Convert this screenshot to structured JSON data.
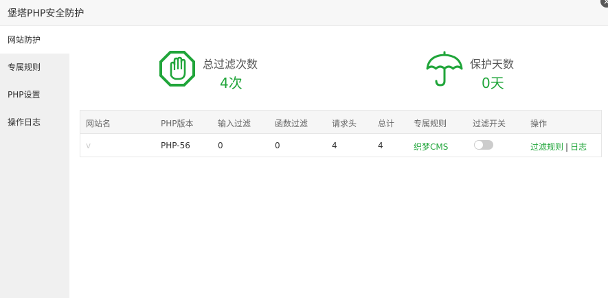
{
  "window": {
    "title": "堡塔PHP安全防护",
    "close_icon": "close-icon"
  },
  "sidebar": {
    "items": [
      {
        "label": "网站防护",
        "active": true
      },
      {
        "label": "专属规则",
        "active": false
      },
      {
        "label": "PHP设置",
        "active": false
      },
      {
        "label": "操作日志",
        "active": false
      }
    ]
  },
  "stats": {
    "filter": {
      "label": "总过滤次数",
      "value": "4次",
      "icon": "stop-hand-icon"
    },
    "protect": {
      "label": "保护天数",
      "value": "0天",
      "icon": "umbrella-icon"
    }
  },
  "colors": {
    "accent": "#20a53a"
  },
  "table": {
    "headers": [
      "网站名",
      "PHP版本",
      "输入过滤",
      "函数过滤",
      "请求头",
      "总计",
      "专属规则",
      "过滤开关",
      "操作"
    ],
    "rows": [
      {
        "site": "v",
        "php": "PHP-56",
        "input_filter": "0",
        "func_filter": "0",
        "header": "4",
        "total": "4",
        "rule": "织梦CMS",
        "switch_on": false,
        "actions": {
          "rules": "过滤规则",
          "sep": "|",
          "log": "日志"
        }
      }
    ]
  }
}
